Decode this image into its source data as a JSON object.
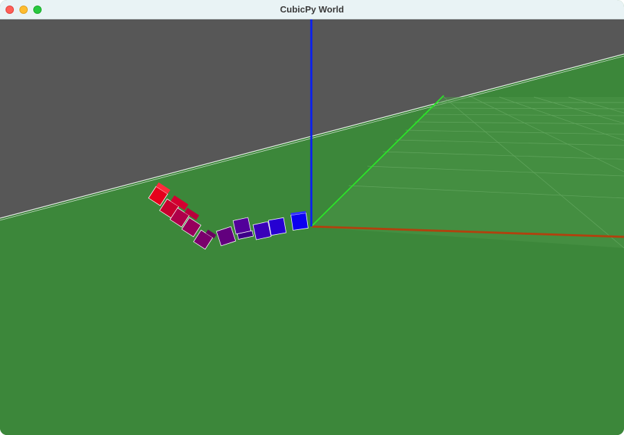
{
  "window": {
    "title": "CubicPy World"
  },
  "traffic_lights": [
    {
      "name": "close-button",
      "color": "#fe5f57"
    },
    {
      "name": "minimize-button",
      "color": "#febc2e"
    },
    {
      "name": "maximize-button",
      "color": "#28c840"
    }
  ],
  "scene": {
    "sky_color": "#575757",
    "ground_color": "#3c873a",
    "axes": {
      "x_color": "#b0420e",
      "y_color": "#2de02a",
      "z_color": "#0a1ff0"
    },
    "cube_colors": [
      "#e6001c",
      "#b0004a",
      "#9a0058",
      "#7d0070",
      "#6a0080",
      "#5a0094",
      "#4a00a8",
      "#3500c0",
      "#2200d8",
      "#1000ec"
    ]
  }
}
